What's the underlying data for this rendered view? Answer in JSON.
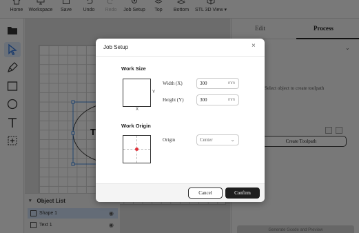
{
  "toolbar": {
    "home": "Home",
    "workspace": "Workspace",
    "save": "Save",
    "undo": "Undo",
    "redo": "Redo",
    "job_setup": "Job Setup",
    "top": "Top",
    "bottom": "Bottom",
    "view": "STL 3D View ▾"
  },
  "left_tools": [
    "folder-icon",
    "cursor-icon",
    "pen-icon",
    "rectangle-icon",
    "ellipse-icon",
    "text-icon",
    "add-frame-icon"
  ],
  "object_list": {
    "title": "Object List",
    "items": [
      {
        "label": "Shape 1",
        "selected": true
      },
      {
        "label": "Text 1",
        "selected": false
      }
    ]
  },
  "right_panel": {
    "tab_edit": "Edit",
    "tab_process": "Process",
    "section_header_fragment": "st",
    "hint": "Select object to create toolpath",
    "create_toolpath": "Create Toolpath",
    "generate": "Generate Gcode and Preview"
  },
  "canvas": {
    "text_fragment": "T"
  },
  "dialog": {
    "title": "Job Setup",
    "close": "×",
    "work_size_label": "Work Size",
    "axis_y": "Y",
    "axis_x": "X",
    "width_label": "Width (X)",
    "width_value": "300",
    "width_unit": "mm",
    "height_label": "Height (Y)",
    "height_value": "300",
    "height_unit": "mm",
    "work_origin_label": "Work Origin",
    "origin_label": "Origin",
    "origin_value": "Center",
    "cancel": "Cancel",
    "confirm": "Confirm"
  },
  "colors": {
    "origin_dot": "#e0303a",
    "confirm_bg": "#1e1e1e",
    "selection": "#1a6fd8"
  }
}
